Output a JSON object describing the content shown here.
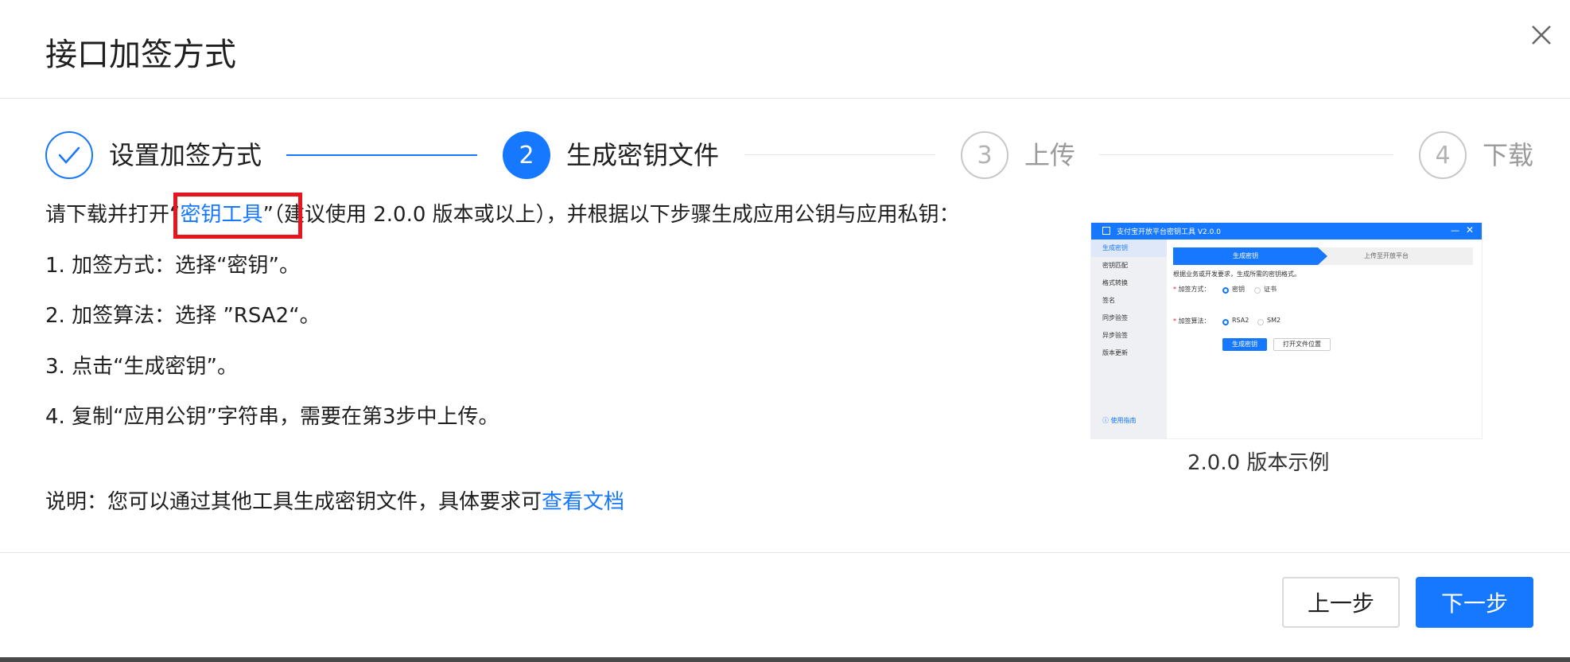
{
  "dialog": {
    "title": "接口加签方式"
  },
  "steps": [
    {
      "number": "1",
      "label": "设置加签方式",
      "status": "done"
    },
    {
      "number": "2",
      "label": "生成密钥文件",
      "status": "active"
    },
    {
      "number": "3",
      "label": "上传",
      "status": "wait"
    },
    {
      "number": "4",
      "label": "下载",
      "status": "wait"
    }
  ],
  "content": {
    "intro_prefix": "请下载并打开“",
    "tool_link": "密钥工具",
    "intro_suffix": "”（建议使用 2.0.0 版本或以上），并根据以下步骤生成应用公钥与应用私钥：",
    "items": [
      "1. 加签方式：选择“密钥”。",
      "2. 加签算法：选择 ”RSA2“。",
      "3. 点击“生成密钥”。",
      "4. 复制“应用公钥”字符串，需要在第3步中上传。"
    ],
    "note_prefix": "说明：您可以通过其他工具生成密钥文件，具体要求可",
    "note_link": "查看文档"
  },
  "preview": {
    "window_title": "支付宝开放平台密钥工具 V2.0.0",
    "sidebar": [
      "生成密钥",
      "密钥匹配",
      "格式转换",
      "签名",
      "同步验签",
      "异步验签",
      "版本更新"
    ],
    "help": "使用指南",
    "tab_active": "生成密钥",
    "tab_next": "上传至开放平台",
    "hint": "根据业务或开发要求，生成所需的密钥格式。",
    "method_label": "加签方式：",
    "method_options": [
      "密钥",
      "证书"
    ],
    "algo_label": "加签算法：",
    "algo_options": [
      "RSA2",
      "SM2"
    ],
    "generate_btn": "生成密钥",
    "open_btn": "打开文件位置",
    "caption": "2.0.0 版本示例"
  },
  "footer": {
    "prev_label": "上一步",
    "next_label": "下一步"
  },
  "colors": {
    "accent": "#1677ff",
    "highlight": "#e5161e"
  }
}
